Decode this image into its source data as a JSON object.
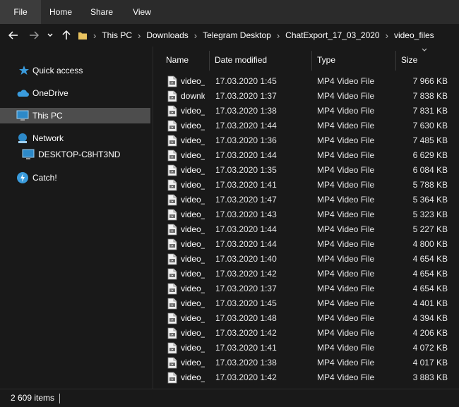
{
  "ribbon": {
    "tabs": [
      {
        "label": "File"
      },
      {
        "label": "Home"
      },
      {
        "label": "Share"
      },
      {
        "label": "View"
      }
    ]
  },
  "address": {
    "crumbs": [
      "This PC",
      "Downloads",
      "Telegram Desktop",
      "ChatExport_17_03_2020",
      "video_files"
    ]
  },
  "nav": {
    "items": [
      {
        "label": "Quick access",
        "icon": "star-icon"
      },
      {
        "label": "OneDrive",
        "icon": "cloud-icon"
      },
      {
        "label": "This PC",
        "icon": "computer-icon"
      },
      {
        "label": "Network",
        "icon": "network-icon"
      },
      {
        "label": "DESKTOP-C8HT3ND",
        "icon": "monitor-icon"
      },
      {
        "label": "Catch!",
        "icon": "catch-icon"
      }
    ]
  },
  "columns": {
    "name": "Name",
    "date": "Date modified",
    "type": "Type",
    "size": "Size"
  },
  "files": [
    {
      "name": "video_file",
      "date": "17.03.2020 1:45",
      "type": "MP4 Video File",
      "size": "7 966 KB"
    },
    {
      "name": "download",
      "date": "17.03.2020 1:37",
      "type": "MP4 Video File",
      "size": "7 838 KB"
    },
    {
      "name": "video_file",
      "date": "17.03.2020 1:38",
      "type": "MP4 Video File",
      "size": "7 831 KB"
    },
    {
      "name": "video_file",
      "date": "17.03.2020 1:44",
      "type": "MP4 Video File",
      "size": "7 630 KB"
    },
    {
      "name": "video_file",
      "date": "17.03.2020 1:36",
      "type": "MP4 Video File",
      "size": "7 485 KB"
    },
    {
      "name": "video_file",
      "date": "17.03.2020 1:44",
      "type": "MP4 Video File",
      "size": "6 629 KB"
    },
    {
      "name": "video_file",
      "date": "17.03.2020 1:35",
      "type": "MP4 Video File",
      "size": "6 084 KB"
    },
    {
      "name": "video_file",
      "date": "17.03.2020 1:41",
      "type": "MP4 Video File",
      "size": "5 788 KB"
    },
    {
      "name": "video_file",
      "date": "17.03.2020 1:47",
      "type": "MP4 Video File",
      "size": "5 364 KB"
    },
    {
      "name": "video_file",
      "date": "17.03.2020 1:43",
      "type": "MP4 Video File",
      "size": "5 323 KB"
    },
    {
      "name": "video_file",
      "date": "17.03.2020 1:44",
      "type": "MP4 Video File",
      "size": "5 227 KB"
    },
    {
      "name": "video_file",
      "date": "17.03.2020 1:44",
      "type": "MP4 Video File",
      "size": "4 800 KB"
    },
    {
      "name": "video_file",
      "date": "17.03.2020 1:40",
      "type": "MP4 Video File",
      "size": "4 654 KB"
    },
    {
      "name": "video_file",
      "date": "17.03.2020 1:42",
      "type": "MP4 Video File",
      "size": "4 654 KB"
    },
    {
      "name": "video_file",
      "date": "17.03.2020 1:37",
      "type": "MP4 Video File",
      "size": "4 654 KB"
    },
    {
      "name": "video_file",
      "date": "17.03.2020 1:45",
      "type": "MP4 Video File",
      "size": "4 401 KB"
    },
    {
      "name": "video_file",
      "date": "17.03.2020 1:48",
      "type": "MP4 Video File",
      "size": "4 394 KB"
    },
    {
      "name": "video_file",
      "date": "17.03.2020 1:42",
      "type": "MP4 Video File",
      "size": "4 206 KB"
    },
    {
      "name": "video_file",
      "date": "17.03.2020 1:41",
      "type": "MP4 Video File",
      "size": "4 072 KB"
    },
    {
      "name": "video_file",
      "date": "17.03.2020 1:38",
      "type": "MP4 Video File",
      "size": "4 017 KB"
    },
    {
      "name": "video_file",
      "date": "17.03.2020 1:42",
      "type": "MP4 Video File",
      "size": "3 883 KB"
    }
  ],
  "status": {
    "item_count": "2 609 items"
  },
  "colors": {
    "background": "#191919",
    "ribbon": "#2b2b2b",
    "selected": "#4d4d4d",
    "folder": "#e8c25f",
    "accent_blue": "#3a9bdc"
  }
}
